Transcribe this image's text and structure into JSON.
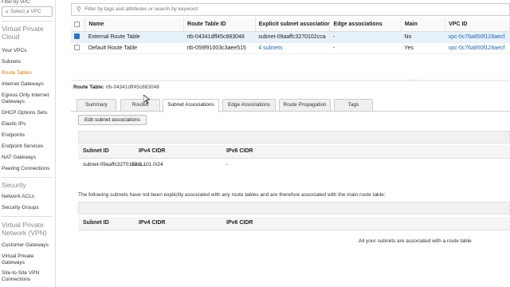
{
  "sidebar": {
    "filter_label": "Filter by VPC:",
    "vpc_select_placeholder": "Select a VPC",
    "sections": [
      {
        "title": "Virtual Private Cloud",
        "items": [
          "Your VPCs",
          "Subnets",
          "Route Tables",
          "Internet Gateways",
          "Egress Only Internet Gateways",
          "DHCP Options Sets",
          "Elastic IPs",
          "Endpoints",
          "Endpoint Services",
          "NAT Gateways",
          "Peering Connections"
        ]
      },
      {
        "title": "Security",
        "items": [
          "Network ACLs",
          "Security Groups"
        ]
      },
      {
        "title": "Virtual Private Network (VPN)",
        "items": [
          "Customer Gateways",
          "Virtual Private Gateways",
          "Site-to-Site VPN Connections"
        ]
      }
    ]
  },
  "search": {
    "placeholder": "Filter by tags and attributes or search by keyword"
  },
  "route_table": {
    "columns": [
      "Name",
      "Route Table ID",
      "Explicit subnet associatior",
      "Edge associations",
      "Main",
      "VPC ID"
    ],
    "rows": [
      {
        "selected": true,
        "name": "External Route Table",
        "id": "rtb-04341dff45c883048",
        "explicit": "subnet-09aaffc3270102cca",
        "edge": "-",
        "main": "No",
        "vpc": "vpc-0c76a850f128aecf"
      },
      {
        "selected": false,
        "name": "Default Route Table",
        "id": "rtb-059f91003c3aee515",
        "explicit": "4 subnets",
        "edge": "-",
        "main": "Yes",
        "vpc": "vpc-0c76a850f128aecf"
      }
    ]
  },
  "detail": {
    "title_label": "Route Table:",
    "title_value": "rtb-04341dff45c883048",
    "tabs": [
      "Summary",
      "Routes",
      "Subnet Associations",
      "Edge Associations",
      "Route Propagation",
      "Tags"
    ],
    "active_tab": "Subnet Associations",
    "edit_button": "Edit subnet associations",
    "assoc_columns": [
      "Subnet ID",
      "IPv4 CIDR",
      "IPv6 CIDR"
    ],
    "assoc_row": {
      "subnet": "subnet-09aaffc3270102cc...",
      "ipv4": "10.0.101.0/24",
      "ipv6": "-"
    },
    "note": "The following subnets have not been explicitly associated with any route tables and are therefore associated with the main route table:",
    "unassoc_columns": [
      "Subnet ID",
      "IPv4 CIDR",
      "IPv6 CIDR"
    ],
    "empty_message": "All your subnets are associated with a route table"
  },
  "colors": {
    "accent": "#e07b00",
    "link": "#1f68b8",
    "selected_row": "#e6f1fa"
  }
}
